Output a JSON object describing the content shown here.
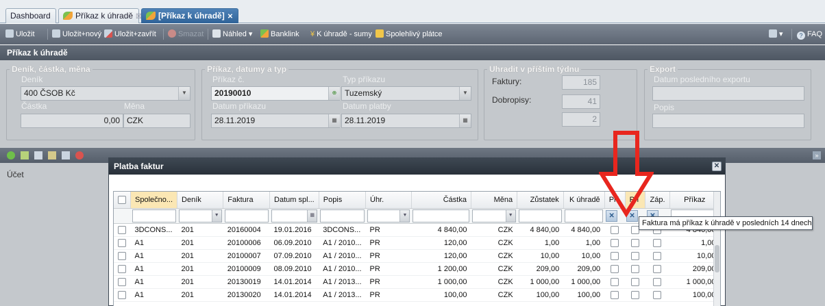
{
  "tabs": [
    {
      "label": "Dashboard"
    },
    {
      "label": "Příkaz k úhradě",
      "close": "☒"
    },
    {
      "label": "[Příkaz k úhradě]",
      "close": "✕"
    }
  ],
  "toolbar": {
    "save": "Uložit",
    "save_new": "Uložit+nový",
    "save_close": "Uložit+zavřít",
    "delete": "Smazat",
    "preview": "Náhled",
    "banklink": "Banklink",
    "to_pay": "K úhradě - sumy",
    "reliable": "Spolehlivý plátce",
    "faq": "FAQ"
  },
  "page_title": "Příkaz k úhradě",
  "deník_section": {
    "legend": "Deník, částka, měna",
    "denik_label": "Deník",
    "denik_value": "400 ČSOB Kč",
    "castka_label": "Částka",
    "castka_value": "0,00",
    "mena_label": "Měna",
    "mena_value": "CZK"
  },
  "prikaz_section": {
    "legend": "Příkaz, datumy a typ",
    "cislo_label": "Příkaz č.",
    "cislo_value": "20190010",
    "typ_label": "Typ příkazu",
    "typ_value": "Tuzemský",
    "datum_label": "Datum příkazu",
    "datum_value": "28.11.2019",
    "platba_label": "Datum platby",
    "platba_value": "28.11.2019"
  },
  "uhradit_section": {
    "legend": "Uhradit v příštím týdnu",
    "faktury_label": "Faktury:",
    "faktury_value": "185",
    "dobropisy_label": "Dobropisy:",
    "dobropisy_value": "41",
    "third_value": "2"
  },
  "export_section": {
    "legend": "Export",
    "datum_label": "Datum posledního exportu",
    "popis_label": "Popis"
  },
  "left_panel": {
    "ucet": "Účet"
  },
  "dialog": {
    "title": "Platba faktur",
    "columns": [
      "Společno...",
      "Deník",
      "Faktura",
      "Datum spl...",
      "Popis",
      "Úhr.",
      "Částka",
      "Měna",
      "Zůstatek",
      "K úhradě",
      "Pří",
      "Při",
      "Záp.",
      "Příkaz"
    ],
    "rows": [
      {
        "spol": "3DCONS...",
        "denik": "201",
        "faktura": "20160004",
        "datum": "19.01.2016",
        "popis": "3DCONS...",
        "uhr": "PR",
        "castka": "4 840,00",
        "mena": "CZK",
        "zustatek": "4 840,00",
        "kuhrade": "4 840,00",
        "prikaz": "4 840,00"
      },
      {
        "spol": "A1",
        "denik": "201",
        "faktura": "20100006",
        "datum": "06.09.2010",
        "popis": "A1 / 2010...",
        "uhr": "PR",
        "castka": "120,00",
        "mena": "CZK",
        "zustatek": "1,00",
        "kuhrade": "1,00",
        "prikaz": "1,00"
      },
      {
        "spol": "A1",
        "denik": "201",
        "faktura": "20100007",
        "datum": "07.09.2010",
        "popis": "A1 / 2010...",
        "uhr": "PR",
        "castka": "120,00",
        "mena": "CZK",
        "zustatek": "10,00",
        "kuhrade": "10,00",
        "prikaz": "10,00"
      },
      {
        "spol": "A1",
        "denik": "201",
        "faktura": "20100009",
        "datum": "08.09.2010",
        "popis": "A1 / 2010...",
        "uhr": "PR",
        "castka": "1 200,00",
        "mena": "CZK",
        "zustatek": "209,00",
        "kuhrade": "209,00",
        "prikaz": "209,00"
      },
      {
        "spol": "A1",
        "denik": "201",
        "faktura": "20130019",
        "datum": "14.01.2014",
        "popis": "A1 / 2013...",
        "uhr": "PR",
        "castka": "1 000,00",
        "mena": "CZK",
        "zustatek": "1 000,00",
        "kuhrade": "1 000,00",
        "prikaz": "1 000,00"
      },
      {
        "spol": "A1",
        "denik": "201",
        "faktura": "20130020",
        "datum": "14.01.2014",
        "popis": "A1 / 2013...",
        "uhr": "PR",
        "castka": "100,00",
        "mena": "CZK",
        "zustatek": "100,00",
        "kuhrade": "100,00",
        "prikaz": "100,00"
      }
    ]
  },
  "tooltip": "Faktura má příkaz k úhradě v posledních 14 dnech",
  "colors": {
    "arrow": "#e8261e",
    "header_highlight": "#fbe7b4"
  }
}
